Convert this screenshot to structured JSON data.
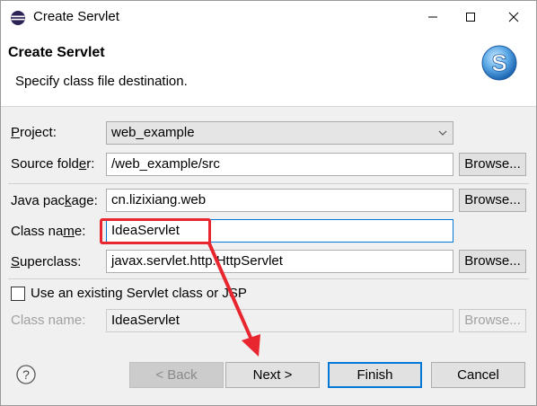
{
  "window": {
    "title": "Create Servlet"
  },
  "banner": {
    "title": "Create Servlet",
    "description": "Specify class file destination."
  },
  "form": {
    "project": {
      "label_pre": "",
      "label_key": "P",
      "label_post": "roject:",
      "value": "web_example"
    },
    "source_folder": {
      "label_pre": "Source fold",
      "label_key": "e",
      "label_post": "r:",
      "value": "/web_example/src",
      "browse": "Browse..."
    },
    "java_package": {
      "label_pre": "Java pac",
      "label_key": "k",
      "label_post": "age:",
      "value": "cn.lizixiang.web",
      "browse": "Browse..."
    },
    "class_name": {
      "label_pre": "Class na",
      "label_key": "m",
      "label_post": "e:",
      "value": "IdeaServlet"
    },
    "superclass": {
      "label_pre": "",
      "label_key": "S",
      "label_post": "uperclass:",
      "value": "javax.servlet.http.HttpServlet",
      "browse": "Browse..."
    },
    "existing": {
      "checkbox_label": "Use an existing Servlet class or JSP",
      "checked": false
    },
    "existing_class": {
      "label": "Class name:",
      "value": "IdeaServlet",
      "browse": "Browse..."
    }
  },
  "buttons": {
    "back": "< Back",
    "next": "Next >",
    "finish": "Finish",
    "cancel": "Cancel"
  },
  "colors": {
    "annotation": "#e8262f",
    "focus": "#0078d7"
  }
}
